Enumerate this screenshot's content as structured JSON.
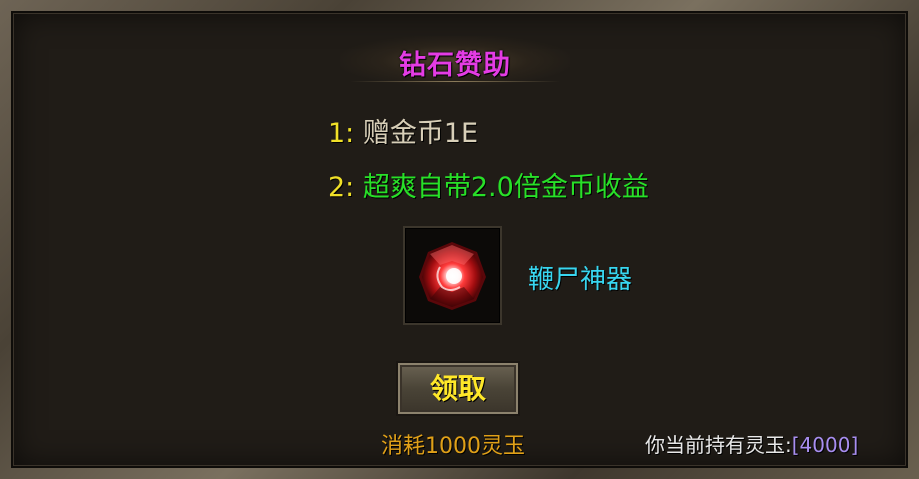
{
  "panel": {
    "title": "钻石赞助",
    "rewards": [
      {
        "index": "1:",
        "text": "赠金币1E"
      },
      {
        "index": "2:",
        "text": "超爽自带2.0倍金币收益"
      }
    ],
    "item": {
      "name": "鞭尸神器",
      "icon": "red-gem-icon"
    },
    "claim_label": "领取",
    "cost_text": "消耗1000灵玉",
    "holding_label": "你当前持有灵玉:",
    "holding_value": "[4000]"
  },
  "colors": {
    "title": "#e43ce4",
    "index": "#f0e028",
    "reward1": "#d8cfb8",
    "reward2": "#28e028",
    "item_name": "#38d6f0",
    "button_text": "#ffe829",
    "cost": "#e0a018",
    "holding_value": "#a88ef0"
  }
}
